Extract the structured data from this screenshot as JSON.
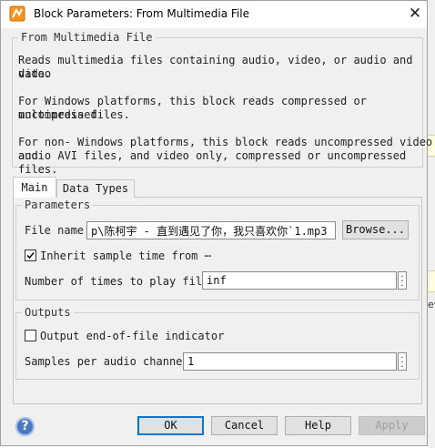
{
  "window": {
    "title": "Block Parameters: From Multimedia File",
    "close_glyph": "✕"
  },
  "description": {
    "legend": "From Multimedia File",
    "p1_line1": "Reads multimedia files containing audio, video, or audio and video",
    "p1_line2": "data.",
    "p2_line1": "For Windows platforms, this block reads compressed or uncompressed",
    "p2_line2": "multimedia files.",
    "p3_line1": "For non- Windows platforms, this block reads uncompressed video and",
    "p3_line2": "audio AVI files, and video only, compressed or uncompressed files."
  },
  "tabs": [
    {
      "label": "Main",
      "active": true
    },
    {
      "label": "Data Types",
      "active": false
    }
  ],
  "parameters": {
    "legend": "Parameters",
    "file_name_label": "File name:",
    "file_name_value": "p\\陈柯宇 - 直到遇见了你，我只喜欢你`1.mp3",
    "browse_label": "Browse...",
    "inherit_label": "Inherit sample time from ⋯",
    "inherit_checked": true,
    "num_plays_label": "Number of times to play file:",
    "num_plays_value": "inf"
  },
  "outputs": {
    "legend": "Outputs",
    "eof_label": "Output end-of-file indicator",
    "eof_checked": false,
    "samples_label": "Samples per audio channel:",
    "samples_value": "1"
  },
  "buttons": {
    "ok": "OK",
    "cancel": "Cancel",
    "help": "Help",
    "apply": "Apply",
    "help_icon_glyph": "?"
  },
  "background": {
    "partial_text": "ev"
  },
  "colors": {
    "dialog_bg": "#f0f0f0",
    "default_button_border": "#0078d7",
    "help_icon": "#4a78c2",
    "background_highlight": "#fffde0"
  }
}
